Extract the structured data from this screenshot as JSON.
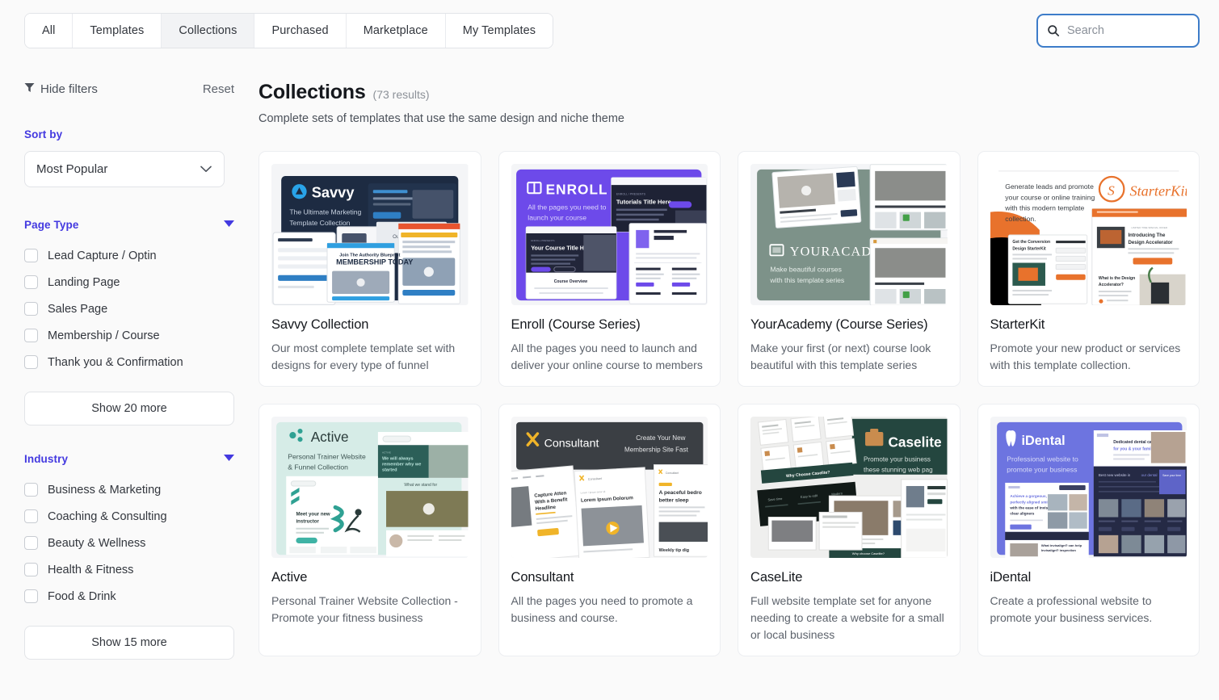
{
  "nav": {
    "tabs": [
      {
        "label": "All",
        "active": false
      },
      {
        "label": "Templates",
        "active": false
      },
      {
        "label": "Collections",
        "active": true
      },
      {
        "label": "Purchased",
        "active": false
      },
      {
        "label": "Marketplace",
        "active": false
      },
      {
        "label": "My Templates",
        "active": false
      }
    ]
  },
  "search": {
    "placeholder": "Search",
    "value": "",
    "icon": "search-icon"
  },
  "sidebar": {
    "hide_filters_label": "Hide filters",
    "reset_label": "Reset",
    "sort": {
      "title": "Sort by",
      "selected": "Most Popular"
    },
    "page_type": {
      "title": "Page Type",
      "options": [
        "Lead Capture / Optin",
        "Landing Page",
        "Sales Page",
        "Membership / Course",
        "Thank you & Confirmation"
      ],
      "show_more_label": "Show 20 more"
    },
    "industry": {
      "title": "Industry",
      "options": [
        "Business & Marketing",
        "Coaching & Consulting",
        "Beauty & Wellness",
        "Health & Fitness",
        "Food & Drink"
      ],
      "show_more_label": "Show 15 more"
    }
  },
  "main": {
    "title": "Collections",
    "results": "(73 results)",
    "subtitle": "Complete sets of templates that use the same design and niche theme",
    "cards": [
      {
        "title": "Savvy Collection",
        "desc": "Our most complete template set with designs for every type of funnel",
        "thumb": {
          "brand": "Savvy",
          "tagline_1": "The Ultimate Marketing",
          "tagline_2": "Template Collection",
          "bg": "#1d2b42",
          "accent": "#29a3e8"
        }
      },
      {
        "title": "Enroll (Course Series)",
        "desc": "All the pages you need to launch and deliver your online course to members",
        "thumb": {
          "brand": "ENROLL",
          "tagline_1": "All the pages you need to",
          "tagline_2": "launch your course",
          "bg": "#6d4aea",
          "accent": "#ffffff"
        }
      },
      {
        "title": "YourAcademy (Course Series)",
        "desc": "Make your first (or next) course look beautiful with this template series",
        "thumb": {
          "brand": "YOURACADEMY",
          "tagline_1": "Make beautiful courses",
          "tagline_2": "with this template series",
          "bg": "#7d9289",
          "accent": "#ffffff"
        }
      },
      {
        "title": "StarterKit",
        "desc": "Promote your new product or services with this template collection.",
        "thumb": {
          "brand": "StarterKit",
          "tagline_1": "Generate leads and promote",
          "tagline_2": "your course or online training",
          "tagline_3": "with this modern template",
          "tagline_4": "collection.",
          "bg": "#ffffff",
          "accent": "#e8722c"
        }
      },
      {
        "title": "Active",
        "desc": "Personal Trainer Website Collection - Promote your fitness business",
        "thumb": {
          "brand": "Active",
          "tagline_1": "Personal Trainer Website",
          "tagline_2": "& Funnel Collection",
          "bg": "#d6ece7",
          "accent": "#2fa193"
        }
      },
      {
        "title": "Consultant",
        "desc": "All the pages you need to promote a business and course.",
        "thumb": {
          "brand": "Consultant",
          "tagline_1": "Create Your New",
          "tagline_2": "Membership Site Fast",
          "bg": "#3b3f44",
          "accent": "#f0b429"
        }
      },
      {
        "title": "CaseLite",
        "desc": "Full website template set for anyone needing to create a website for a small or local business",
        "thumb": {
          "brand": "Caselite",
          "tagline_1": "Promote your business",
          "tagline_2": "these stunning web pag",
          "bg": "#24463f",
          "accent": "#c98c4e"
        }
      },
      {
        "title": "iDental",
        "desc": "Create a professional website to promote your business services.",
        "thumb": {
          "brand": "iDental",
          "tagline_1": "Professional website to",
          "tagline_2": "promote your business",
          "bg": "#6d74e0",
          "accent": "#ffffff"
        }
      }
    ]
  }
}
